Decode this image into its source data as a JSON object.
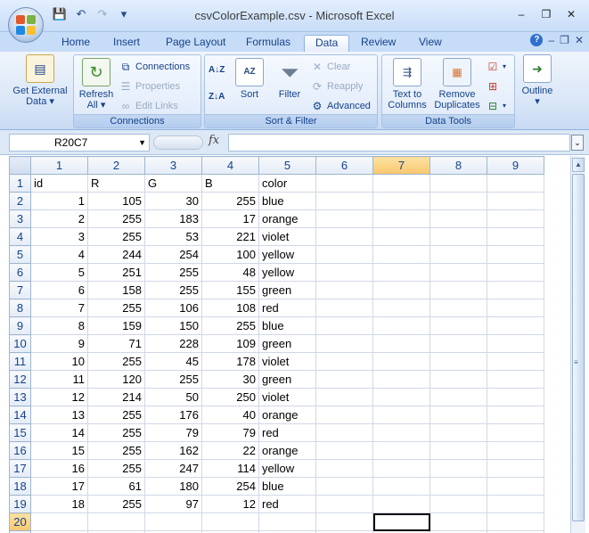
{
  "window": {
    "title": "csvColorExample.csv - Microsoft Excel",
    "minimize": "–",
    "restore": "❐",
    "close": "✕"
  },
  "qat": {
    "save": "💾",
    "undo": "↶",
    "redo": "↷",
    "customize": "▾"
  },
  "tabs": [
    {
      "label": "Home"
    },
    {
      "label": "Insert"
    },
    {
      "label": "Page Layout"
    },
    {
      "label": "Formulas"
    },
    {
      "label": "Data"
    },
    {
      "label": "Review"
    },
    {
      "label": "View"
    }
  ],
  "tab_controls": {
    "help": "?",
    "min": "–",
    "restore": "❐",
    "close": "✕"
  },
  "ribbon": {
    "groups": {
      "connections": "Connections",
      "sort_filter": "Sort & Filter",
      "data_tools": "Data Tools"
    },
    "get_external": {
      "line1": "Get External",
      "line2": "Data ▾"
    },
    "refresh": {
      "line1": "Refresh",
      "line2": "All ▾"
    },
    "connections_btn": "Connections",
    "properties_btn": "Properties",
    "edit_links_btn": "Edit Links",
    "sort_az": "A↓Z",
    "sort_za": "Z↓A",
    "sort_btn": "Sort",
    "filter_btn": "Filter",
    "clear_btn": "Clear",
    "reapply_btn": "Reapply",
    "advanced_btn": "Advanced",
    "text_to_columns": {
      "line1": "Text to",
      "line2": "Columns"
    },
    "remove_duplicates": {
      "line1": "Remove",
      "line2": "Duplicates"
    },
    "outline": {
      "line1": "Outline",
      "line2": "▾"
    }
  },
  "formula_bar": {
    "name_box": "R20C7",
    "fx": "fx",
    "value": ""
  },
  "sheet": {
    "col_headers": [
      "1",
      "2",
      "3",
      "4",
      "5",
      "6",
      "7",
      "8",
      "9"
    ],
    "selected_col": "7",
    "selected_row": "20",
    "header_row": [
      "id",
      "R",
      "G",
      "B",
      "color"
    ],
    "rows": [
      [
        "1",
        "105",
        "30",
        "255",
        "blue"
      ],
      [
        "2",
        "255",
        "183",
        "17",
        "orange"
      ],
      [
        "3",
        "255",
        "53",
        "221",
        "violet"
      ],
      [
        "4",
        "244",
        "254",
        "100",
        "yellow"
      ],
      [
        "5",
        "251",
        "255",
        "48",
        "yellow"
      ],
      [
        "6",
        "158",
        "255",
        "155",
        "green"
      ],
      [
        "7",
        "255",
        "106",
        "108",
        "red"
      ],
      [
        "8",
        "159",
        "150",
        "255",
        "blue"
      ],
      [
        "9",
        "71",
        "228",
        "109",
        "green"
      ],
      [
        "10",
        "255",
        "45",
        "178",
        "violet"
      ],
      [
        "11",
        "120",
        "255",
        "30",
        "green"
      ],
      [
        "12",
        "214",
        "50",
        "250",
        "violet"
      ],
      [
        "13",
        "255",
        "176",
        "40",
        "orange"
      ],
      [
        "14",
        "255",
        "79",
        "79",
        "red"
      ],
      [
        "15",
        "255",
        "162",
        "22",
        "orange"
      ],
      [
        "16",
        "255",
        "247",
        "114",
        "yellow"
      ],
      [
        "17",
        "61",
        "180",
        "254",
        "blue"
      ],
      [
        "18",
        "255",
        "97",
        "12",
        "red"
      ]
    ]
  },
  "colors": {
    "accent": "#15428b",
    "selected_header": "#f9c66d",
    "ribbon": "#d7e5f7"
  }
}
